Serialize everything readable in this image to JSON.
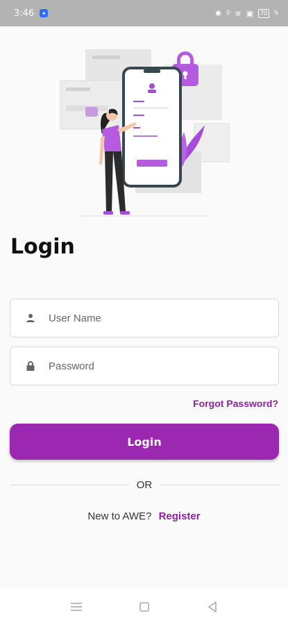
{
  "status": {
    "time": "3:46",
    "battery": "70"
  },
  "page": {
    "title": "Login"
  },
  "form": {
    "username_placeholder": "User Name",
    "password_placeholder": "Password",
    "forgot_label": "Forgot Password?",
    "login_label": "Login"
  },
  "divider": {
    "label": "OR"
  },
  "register": {
    "question": "New to AWE?",
    "link_label": "Register"
  },
  "colors": {
    "accent": "#9c27b0",
    "link": "#8e1fa3"
  },
  "icons": {
    "username": "person-icon",
    "password": "lock-icon",
    "nav_menu": "menu-icon",
    "nav_home": "square-icon",
    "nav_back": "back-triangle-icon"
  }
}
